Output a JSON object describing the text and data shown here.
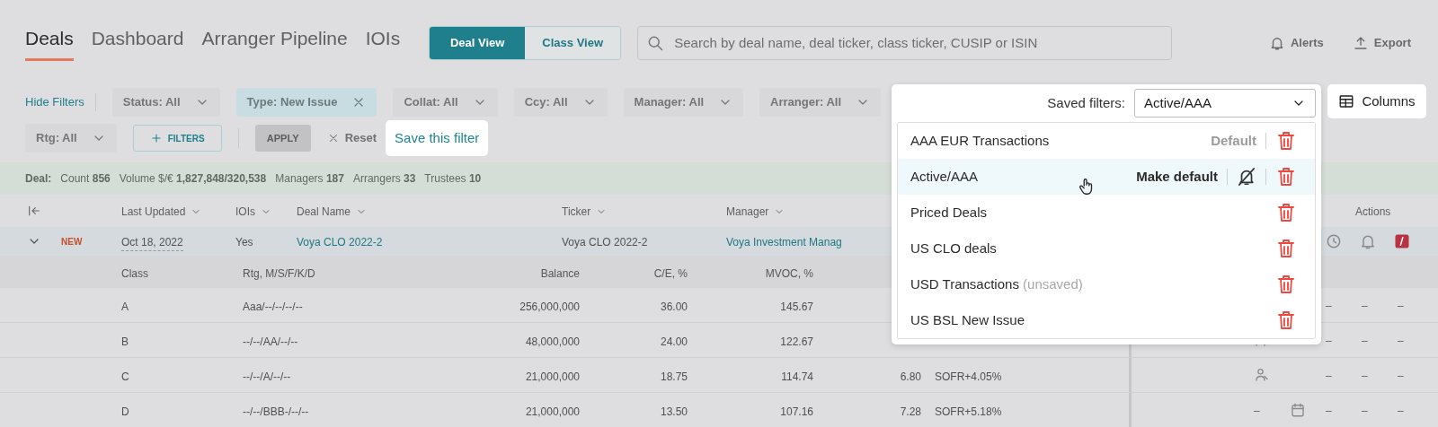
{
  "tabs": [
    {
      "label": "Deals",
      "selected": true
    },
    {
      "label": "Dashboard",
      "selected": false
    },
    {
      "label": "Arranger Pipeline",
      "selected": false
    },
    {
      "label": "IOIs",
      "selected": false
    }
  ],
  "view_toggle": [
    {
      "label": "Deal View",
      "selected": true
    },
    {
      "label": "Class View",
      "selected": false
    }
  ],
  "search": {
    "placeholder": "Search by deal name, deal ticker, class ticker, CUSIP or ISIN"
  },
  "header_actions": [
    {
      "kind": "bell",
      "label": "Alerts"
    },
    {
      "kind": "upload",
      "label": "Export"
    }
  ],
  "filters": {
    "toggle": "Hide Filters",
    "chips": [
      {
        "label": "Status: All",
        "active": false
      },
      {
        "label": "Type: New Issue",
        "active": true
      },
      {
        "label": "Collat: All",
        "active": false
      },
      {
        "label": "Ccy: All",
        "active": false
      },
      {
        "label": "Manager: All",
        "active": false
      },
      {
        "label": "Arranger: All",
        "active": false
      }
    ],
    "row2_chips": [
      {
        "label": "Rtg: All",
        "active": false
      }
    ],
    "add": "FILTERS",
    "apply": {
      "label": "APPLY",
      "disabled": true
    },
    "reset": "Reset",
    "save": "Save this filter"
  },
  "summary": {
    "title": "Deal:",
    "stats": [
      {
        "label": "Count",
        "value": "856"
      },
      {
        "label": "Volume $/€",
        "value": "1,827,848/320,538"
      },
      {
        "label": "Managers",
        "value": "187"
      },
      {
        "label": "Arrangers",
        "value": "33"
      },
      {
        "label": "Trustees",
        "value": "10"
      }
    ]
  },
  "table": {
    "columns": [
      "Last Updated",
      "IOIs",
      "Deal Name",
      "Ticker",
      "Manager"
    ],
    "actions_column": "Actions",
    "deal_row": {
      "expanded": true,
      "badge": "NEW",
      "cells": [
        "Oct 18, 2022",
        "Yes",
        "Voya CLO 2022-2",
        "Voya CLO 2022-2",
        "Voya Investment Manag"
      ]
    },
    "class_columns": [
      "Class",
      "Rtg, M/S/F/K/D",
      "Balance",
      "C/E, %",
      "MVOC, %"
    ],
    "class_rows": [
      {
        "cells": [
          "A",
          "Aaa/--/--/--/--",
          "256,000,000",
          "36.00",
          "145.67"
        ],
        "actions": [
          {
            "kind": "blank"
          },
          {
            "kind": "blank"
          },
          {
            "kind": "dash",
            "text": "–"
          },
          {
            "kind": "dash",
            "text": "–"
          },
          {
            "kind": "dash",
            "text": "–"
          }
        ]
      },
      {
        "cells": [
          "B",
          "--/--/AA/--/--",
          "48,000,000",
          "24.00",
          "122.67"
        ],
        "actions": [
          {
            "kind": "person"
          },
          {
            "kind": "blank"
          },
          {
            "kind": "dash",
            "text": "–"
          },
          {
            "kind": "dash",
            "text": "–"
          },
          {
            "kind": "dash",
            "text": "–"
          }
        ]
      },
      {
        "cells": [
          "C",
          "--/--/A/--/--",
          "21,000,000",
          "18.75",
          "114.74",
          "6.80",
          "SOFR+4.05%"
        ],
        "actions": [
          {
            "kind": "person"
          },
          {
            "kind": "blank"
          },
          {
            "kind": "dash",
            "text": "–"
          },
          {
            "kind": "dash",
            "text": "–"
          },
          {
            "kind": "dash",
            "text": "–"
          }
        ]
      },
      {
        "cells": [
          "D",
          "--/--/BBB-/--/--",
          "21,000,000",
          "13.50",
          "107.16",
          "7.28",
          "SOFR+5.18%"
        ],
        "actions": [
          {
            "kind": "dash",
            "text": "–"
          },
          {
            "kind": "calendar"
          },
          {
            "kind": "dash",
            "text": "–"
          },
          {
            "kind": "dash",
            "text": "–"
          },
          {
            "kind": "dash",
            "text": "–"
          }
        ]
      }
    ]
  },
  "saved_filters": {
    "label": "Saved filters:",
    "value": "Active/AAA",
    "items": [
      {
        "name": "AAA EUR Transactions",
        "selected": false,
        "action": {
          "kind": "default",
          "label": "Default"
        }
      },
      {
        "name": "Active/AAA",
        "selected": true,
        "action": {
          "kind": "make_default",
          "label": "Make default"
        }
      },
      {
        "name": "Priced Deals",
        "selected": false
      },
      {
        "name": "US CLO deals",
        "selected": false
      },
      {
        "name": "USD Transactions",
        "note": "(unsaved)",
        "selected": false
      },
      {
        "name": "US BSL New Issue",
        "selected": false
      }
    ]
  },
  "columns_button": "Columns"
}
